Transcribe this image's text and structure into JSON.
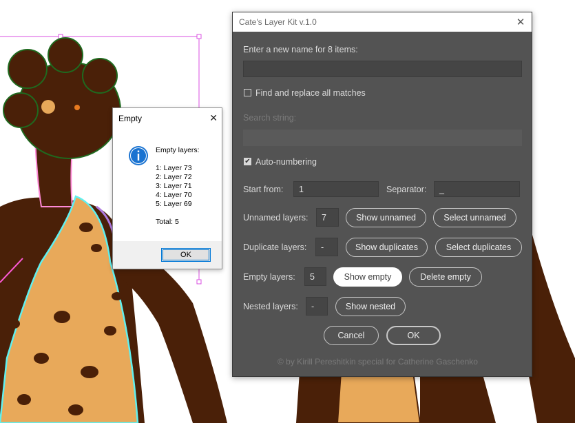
{
  "panel": {
    "title": "Cate's Layer Kit v.1.0",
    "rename_label": "Enter a new name for 8 items:",
    "rename_value": "",
    "find_replace_label": "Find and replace all matches",
    "find_replace_checked": false,
    "search_label": "Search string:",
    "search_value": "",
    "auto_numbering_label": "Auto-numbering",
    "auto_numbering_checked": true,
    "start_from_label": "Start from:",
    "start_from_value": "1",
    "separator_label": "Separator:",
    "separator_value": "_",
    "unnamed_label": "Unnamed layers:",
    "unnamed_count": "7",
    "show_unnamed": "Show unnamed",
    "select_unnamed": "Select unnamed",
    "duplicate_label": "Duplicate layers:",
    "duplicate_count": "-",
    "show_duplicates": "Show duplicates",
    "select_duplicates": "Select duplicates",
    "empty_label": "Empty layers:",
    "empty_count": "5",
    "show_empty": "Show empty",
    "delete_empty": "Delete empty",
    "nested_label": "Nested layers:",
    "nested_count": "-",
    "show_nested": "Show nested",
    "cancel": "Cancel",
    "ok": "OK",
    "footer": "© by Kirill Pereshitkin special for Catherine Gaschenko"
  },
  "empty_dialog": {
    "title": "Empty",
    "heading": "Empty layers:",
    "items": [
      "1: Layer 73",
      "2: Layer 72",
      "3: Layer 71",
      "4: Layer 70",
      "5: Layer 69"
    ],
    "total": "Total: 5",
    "ok": "OK",
    "icon": "info-icon"
  },
  "colors": {
    "panel_bg": "#535353",
    "skin": "#4a2008",
    "selection_magenta": "#d84fe0",
    "path_cyan": "#5ff0f0",
    "path_green": "#1f6a1f",
    "leopard_fill": "#e8a95a"
  }
}
